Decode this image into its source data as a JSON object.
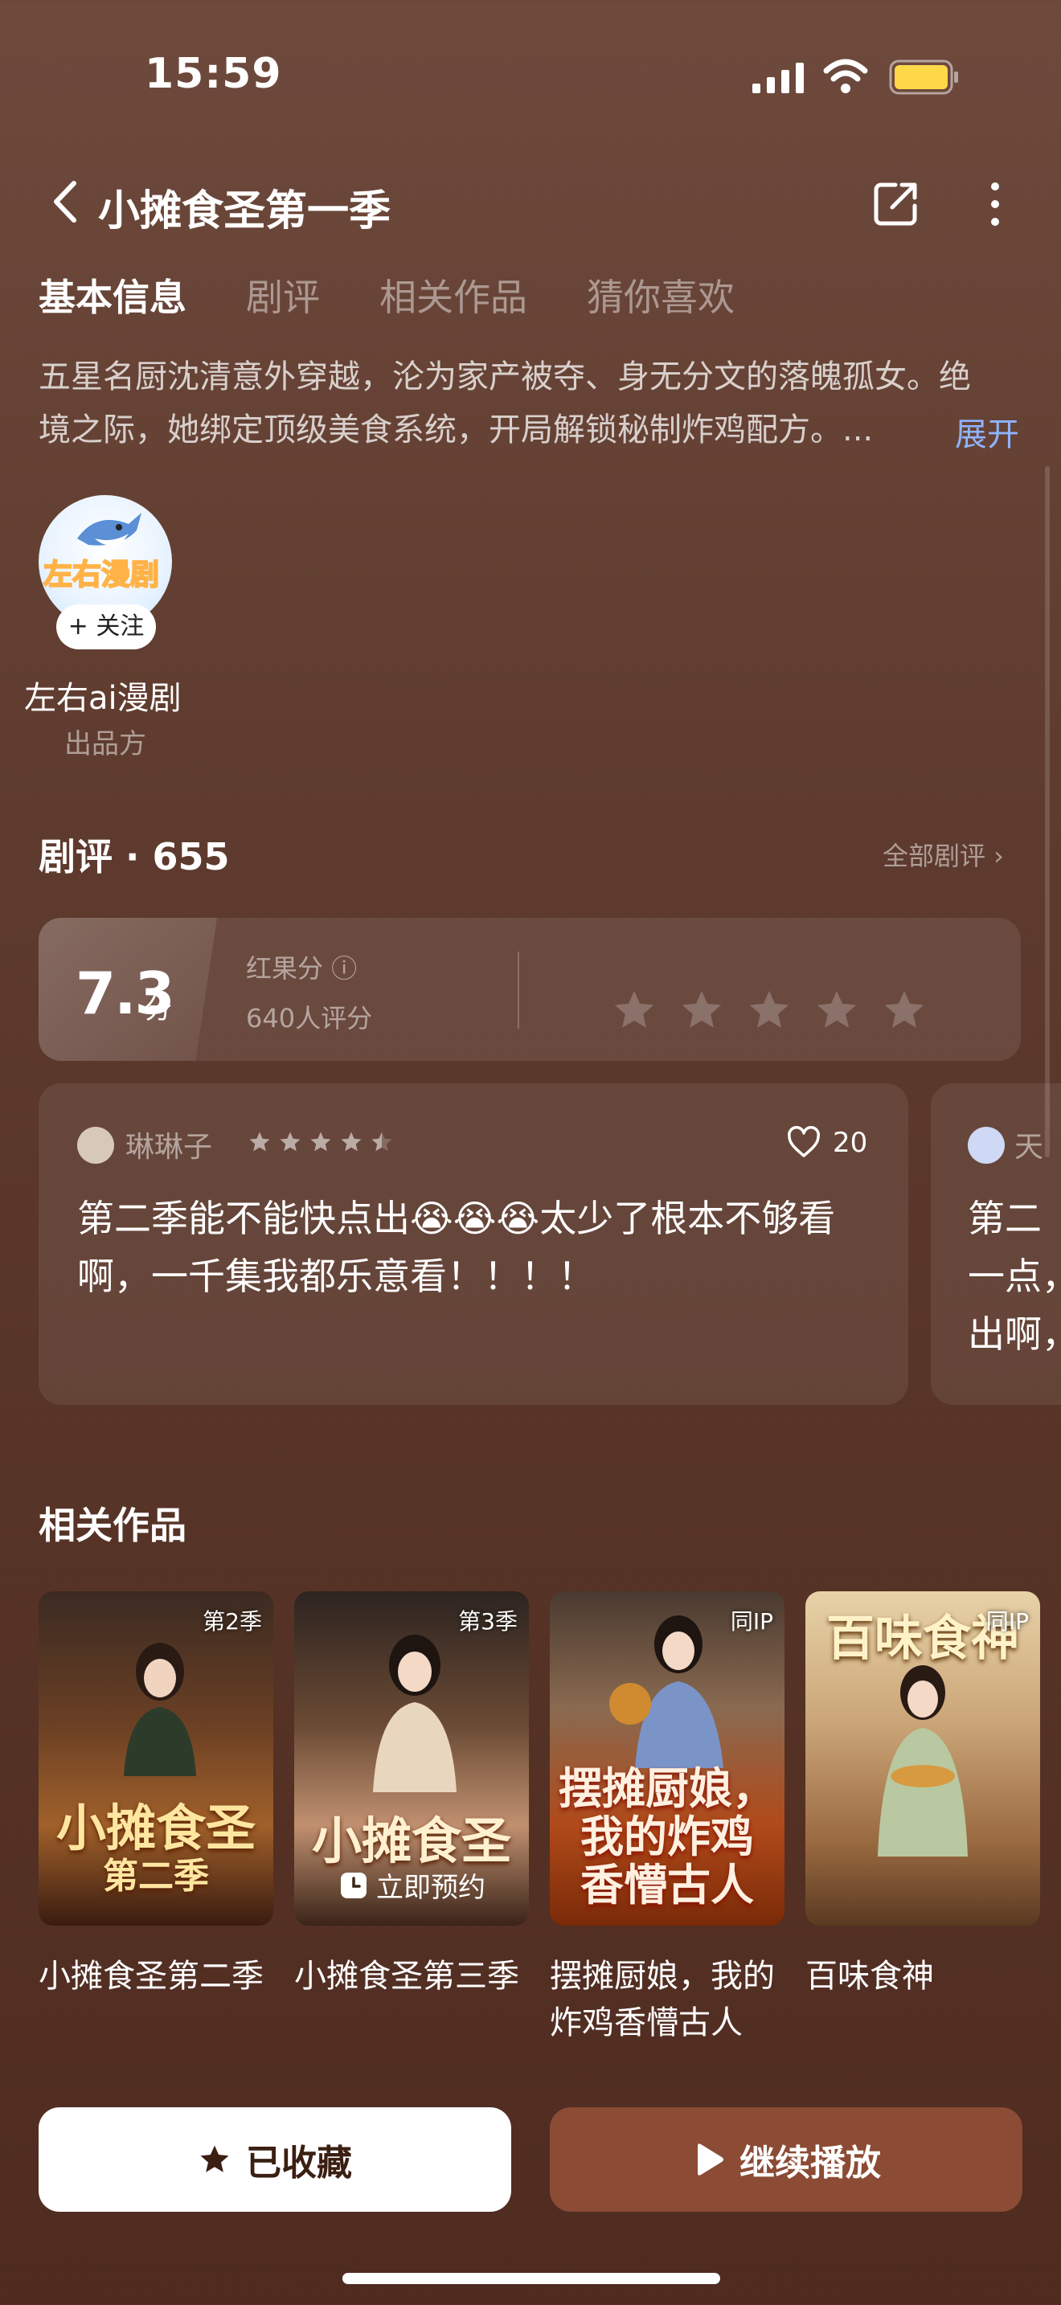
{
  "status_bar": {
    "time": "15:59"
  },
  "nav": {
    "title": "小摊食圣第一季"
  },
  "tabs": [
    {
      "label": "基本信息",
      "active": true
    },
    {
      "label": "剧评",
      "active": false
    },
    {
      "label": "相关作品",
      "active": false
    },
    {
      "label": "猜你喜欢",
      "active": false
    }
  ],
  "intro": {
    "line1": "五星名厨沈清意外穿越，沦为家产被夺、身无分文的落魄孤女。绝",
    "line2": "境之际，她绑定顶级美食系统，开局解锁秘制炸鸡配方。...",
    "expand_label": "展开"
  },
  "producer": {
    "avatar_text": "左右漫剧",
    "follow_label": "+ 关注",
    "name": "左右ai漫剧",
    "role": "出品方"
  },
  "reviews": {
    "title": "剧评 · 655",
    "all_label": "全部剧评 ›",
    "score": "7.3",
    "score_unit": "分",
    "score_label": "红果分 ⓘ",
    "rating_count": "640人评分",
    "items": [
      {
        "user": "琳琳子",
        "stars": 4.5,
        "likes": "20",
        "text": "第二季能不能快点出😭😭😭太少了根本不够看啊，一千集我都乐意看！！！！"
      },
      {
        "user": "天",
        "text_l1": "第二",
        "text_l2": "一点，",
        "text_l3": "出啊，"
      }
    ]
  },
  "related": {
    "title": "相关作品",
    "items": [
      {
        "badge": "第2季",
        "cover_text": "小摊食圣",
        "cover_sub": "第二季",
        "name": "小摊食圣第二季"
      },
      {
        "badge": "第3季",
        "cover_text": "小摊食圣",
        "reserve": "立即预约",
        "name": "小摊食圣第三季"
      },
      {
        "badge": "同IP",
        "cover_text": "摆摊厨娘，",
        "cover_sub": "我的炸鸡",
        "cover_sub2": "香懵古人",
        "name": "摆摊厨娘，我的炸鸡香懵古人"
      },
      {
        "badge": "同IP",
        "cover_top": "百味食神",
        "name": "百味食神"
      }
    ]
  },
  "actions": {
    "favorite_label": "已收藏",
    "play_label": "继续播放"
  },
  "colors": {
    "accent": "#8b4b34",
    "link": "#8fb4ff",
    "background": "#5e3b2e"
  }
}
